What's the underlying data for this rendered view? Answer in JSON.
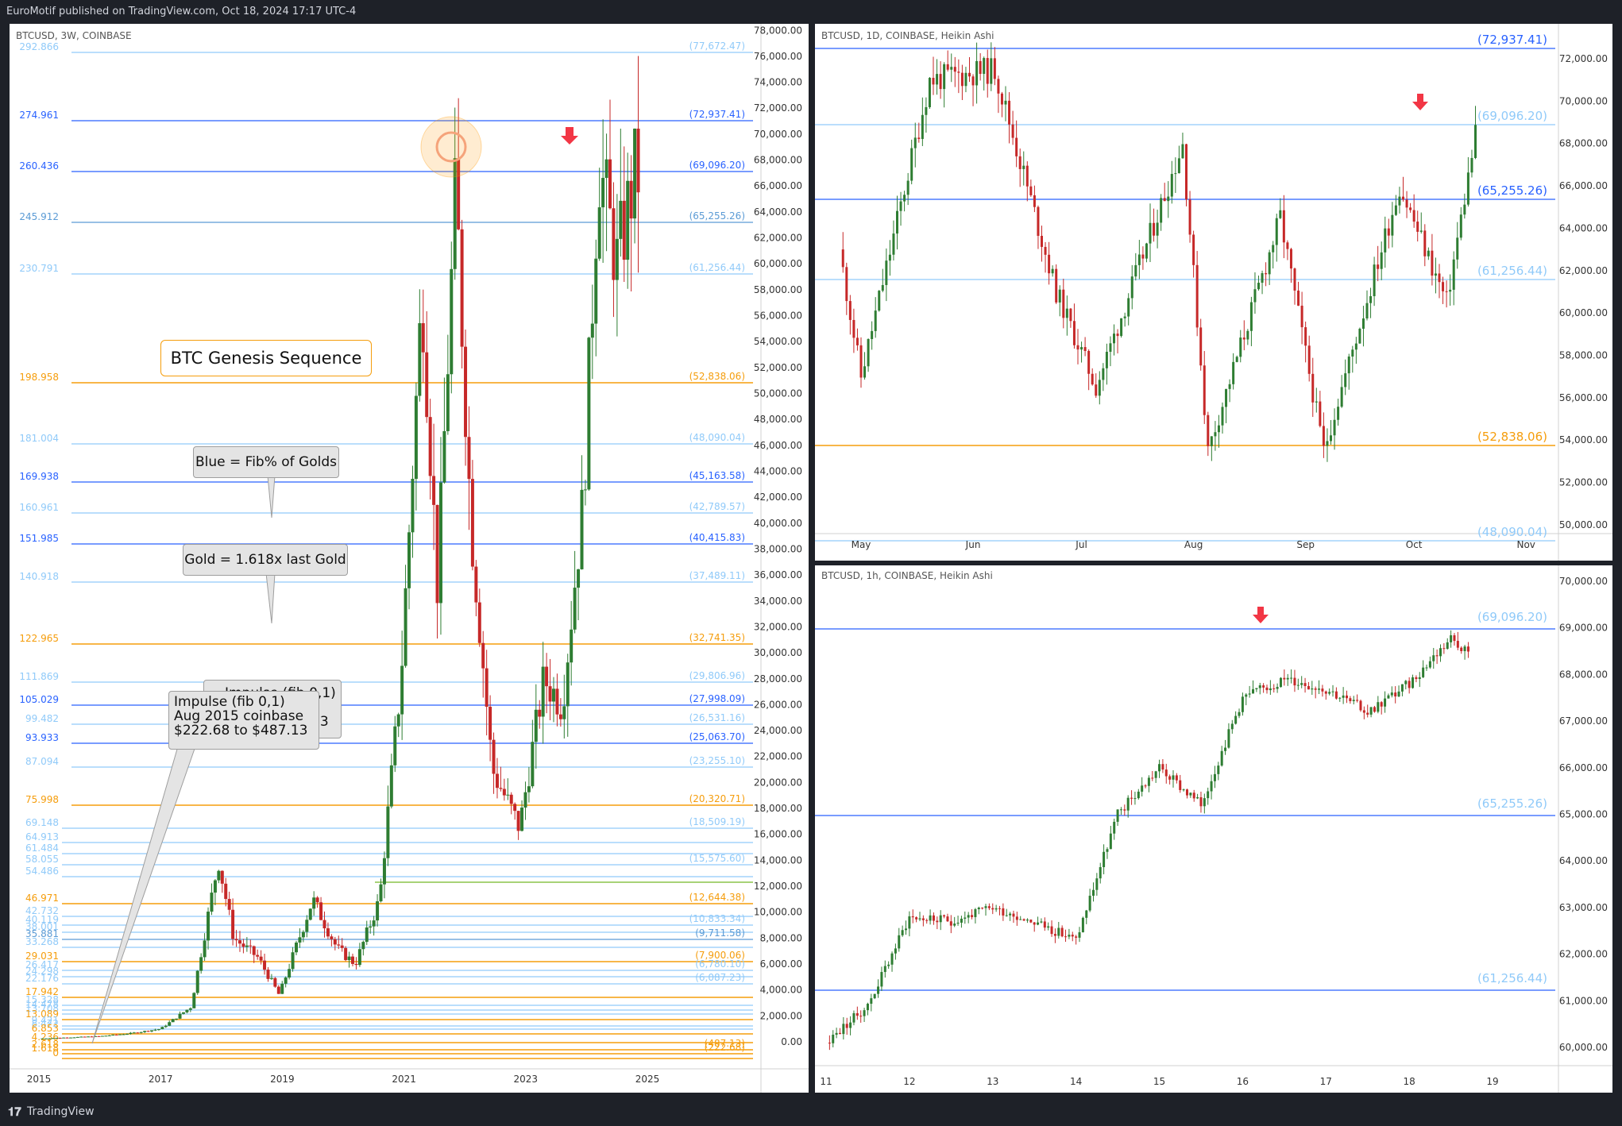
{
  "topbar": {
    "text": "EuroMotif published on TradingView.com, Oct 18, 2024 17:17 UTC-4"
  },
  "bottombar": {
    "brand": "TradingView"
  },
  "colors": {
    "blue": "#2962ff",
    "lightblue": "#90caf9",
    "midblue": "#5b9bd5",
    "orange": "#f59d0c",
    "green": "#2e7d32",
    "red": "#c62828",
    "arrow": "#f23645"
  },
  "left_panel": {
    "header": "BTCUSD, 3W, COINBASE",
    "callouts": {
      "genesis": "BTC Genesis Sequence",
      "blue_note": "Blue = Fib% of Golds",
      "gold_note": "Gold = 1.618x last Gold",
      "impulse_line1": "Impulse (fib 0,1)",
      "impulse_line2": "Aug 2015 coinbase",
      "impulse_line3": "$222.68 to $487.13",
      "impulse_ghost1": "Impulse (fib 0,1)",
      "impulse_ghost2": "se",
      "impulse_ghost3": "13"
    },
    "fib_levels": [
      {
        "pct": "292.866",
        "price": "(77,672.47)",
        "y": 36,
        "c": "lb"
      },
      {
        "pct": "274.961",
        "price": "(72,937.41)",
        "y": 122,
        "c": "b"
      },
      {
        "pct": "260.436",
        "price": "(69,096.20)",
        "y": 186,
        "c": "b"
      },
      {
        "pct": "245.912",
        "price": "(65,255.26)",
        "y": 250,
        "c": "mb"
      },
      {
        "pct": "230.791",
        "price": "(61,256.44)",
        "y": 315,
        "c": "lb"
      },
      {
        "pct": "198.958",
        "price": "(52,838.06)",
        "y": 452,
        "c": "o"
      },
      {
        "pct": "181.004",
        "price": "(48,090.04)",
        "y": 529,
        "c": "lb"
      },
      {
        "pct": "169.938",
        "price": "(45,163.58)",
        "y": 577,
        "c": "b"
      },
      {
        "pct": "160.961",
        "price": "(42,789.57)",
        "y": 616,
        "c": "lb"
      },
      {
        "pct": "151.985",
        "price": "(40,415.83)",
        "y": 655,
        "c": "b"
      },
      {
        "pct": "140.918",
        "price": "(37,489.11)",
        "y": 703,
        "c": "lb"
      },
      {
        "pct": "122.965",
        "price": "(32,741.35)",
        "y": 781,
        "c": "o"
      },
      {
        "pct": "111.869",
        "price": "(29,806.96)",
        "y": 829,
        "c": "lb"
      },
      {
        "pct": "105.029",
        "price": "(27,998.09)",
        "y": 858,
        "c": "b"
      },
      {
        "pct": "99.482",
        "price": "(26,531.16)",
        "y": 882,
        "c": "lb"
      },
      {
        "pct": "93.933",
        "price": "(25,063.70)",
        "y": 906,
        "c": "b"
      },
      {
        "pct": "87.094",
        "price": "(23,255.10)",
        "y": 936,
        "c": "lb"
      },
      {
        "pct": "75.998",
        "price": "(20,320.71)",
        "y": 984,
        "c": "o"
      },
      {
        "pct": "69.148",
        "price": "(18,509.19)",
        "y": 1013,
        "c": "lb"
      },
      {
        "pct": "64.913",
        "price": "",
        "y": 1031,
        "c": "lb"
      },
      {
        "pct": "61.484",
        "price": "",
        "y": 1045,
        "c": "lb"
      },
      {
        "pct": "58.055",
        "price": "(15,575.60)",
        "y": 1059,
        "c": "lb"
      },
      {
        "pct": "54.486",
        "price": "",
        "y": 1074,
        "c": "lb"
      },
      {
        "pct": "46.971",
        "price": "(12,644.38)",
        "y": 1108,
        "c": "o"
      },
      {
        "pct": "42.732",
        "price": "",
        "y": 1124,
        "c": "lb"
      },
      {
        "pct": "40.119",
        "price": "(10,833.34)",
        "y": 1135,
        "c": "lb"
      },
      {
        "pct": "38.001",
        "price": "",
        "y": 1144,
        "c": "lb"
      },
      {
        "pct": "35.881",
        "price": "(9,711.58)",
        "y": 1153,
        "c": "mb"
      },
      {
        "pct": "33.268",
        "price": "",
        "y": 1163,
        "c": "lb"
      },
      {
        "pct": "29.031",
        "price": "(7,900.06)",
        "y": 1181,
        "c": "o"
      },
      {
        "pct": "26.417",
        "price": "(6,780.10)",
        "y": 1192,
        "c": "lb"
      },
      {
        "pct": "24.298",
        "price": "",
        "y": 1200,
        "c": "lb"
      },
      {
        "pct": "22.176",
        "price": "(6,087.23)",
        "y": 1209,
        "c": "lb"
      },
      {
        "pct": "17.942",
        "price": "",
        "y": 1226,
        "c": "o"
      },
      {
        "pct": "15.328",
        "price": "",
        "y": 1236,
        "c": "lb"
      },
      {
        "pct": "14.478",
        "price": "",
        "y": 1242,
        "c": "lb"
      },
      {
        "pct": "13.708",
        "price": "",
        "y": 1247,
        "c": "lb"
      },
      {
        "pct": "13.089",
        "price": "",
        "y": 1254,
        "c": "o"
      },
      {
        "pct": "9.421",
        "price": "",
        "y": 1262,
        "c": "lb"
      },
      {
        "pct": "8.472",
        "price": "",
        "y": 1266,
        "c": "lb"
      },
      {
        "pct": "6.853",
        "price": "",
        "y": 1272,
        "c": "o"
      },
      {
        "pct": "4.236",
        "price": "",
        "y": 1283,
        "c": "o"
      },
      {
        "pct": "2.618",
        "price": "(487.13)",
        "y": 1292,
        "c": "o"
      },
      {
        "pct": "1.618",
        "price": "(222.68)",
        "y": 1297,
        "c": "o"
      },
      {
        "pct": "0",
        "price": "",
        "y": 1303,
        "c": "o"
      }
    ],
    "y_ticks": [
      "78,000.00",
      "76,000.00",
      "74,000.00",
      "72,000.00",
      "70,000.00",
      "68,000.00",
      "66,000.00",
      "64,000.00",
      "62,000.00",
      "60,000.00",
      "58,000.00",
      "56,000.00",
      "54,000.00",
      "52,000.00",
      "50,000.00",
      "48,000.00",
      "46,000.00",
      "44,000.00",
      "42,000.00",
      "40,000.00",
      "38,000.00",
      "36,000.00",
      "34,000.00",
      "32,000.00",
      "30,000.00",
      "28,000.00",
      "26,000.00",
      "24,000.00",
      "22,000.00",
      "20,000.00",
      "18,000.00",
      "16,000.00",
      "14,000.00",
      "12,000.00",
      "10,000.00",
      "8,000.00",
      "6,000.00",
      "4,000.00",
      "2,000.00",
      "0.00"
    ],
    "x_ticks": [
      "2015",
      "2017",
      "2019",
      "2021",
      "2023",
      "2025"
    ]
  },
  "right_top": {
    "header": "BTCUSD, 1D, COINBASE, Heikin Ashi",
    "levels": [
      {
        "price": "(72,937.41)",
        "c": "b"
      },
      {
        "price": "(69,096.20)",
        "c": "lb"
      },
      {
        "price": "(65,255.26)",
        "c": "b"
      },
      {
        "price": "(61,256.44)",
        "c": "lb"
      },
      {
        "price": "(52,838.06)",
        "c": "o"
      },
      {
        "price": "(48,090.04)",
        "c": "lb"
      }
    ],
    "y_ticks": [
      "72,000.00",
      "70,000.00",
      "68,000.00",
      "66,000.00",
      "64,000.00",
      "62,000.00",
      "60,000.00",
      "58,000.00",
      "56,000.00",
      "54,000.00",
      "52,000.00",
      "50,000.00"
    ],
    "x_ticks": [
      "May",
      "Jun",
      "Jul",
      "Aug",
      "Sep",
      "Oct",
      "Nov"
    ]
  },
  "right_bottom": {
    "header": "BTCUSD, 1h, COINBASE, Heikin Ashi",
    "levels": [
      {
        "price": "(69,096.20)",
        "c": "lb"
      },
      {
        "price": "(65,255.26)",
        "c": "lb"
      },
      {
        "price": "(61,256.44)",
        "c": "lb"
      }
    ],
    "y_ticks": [
      "70,000.00",
      "69,000.00",
      "68,000.00",
      "67,000.00",
      "66,000.00",
      "65,000.00",
      "64,000.00",
      "63,000.00",
      "62,000.00",
      "61,000.00",
      "60,000.00"
    ],
    "x_ticks": [
      "11",
      "12",
      "13",
      "14",
      "15",
      "16",
      "17",
      "18",
      "19"
    ]
  },
  "chart_data": [
    {
      "type": "candlestick",
      "title": "BTCUSD, 3W, COINBASE",
      "ylim": [
        0,
        78000
      ],
      "x_ticks": [
        "2015",
        "2017",
        "2019",
        "2021",
        "2023",
        "2025"
      ],
      "close_path": [
        [
          2015.0,
          250
        ],
        [
          2016.0,
          430
        ],
        [
          2016.5,
          650
        ],
        [
          2017.0,
          1000
        ],
        [
          2017.5,
          2700
        ],
        [
          2017.95,
          14000
        ],
        [
          2018.2,
          8000
        ],
        [
          2018.6,
          6500
        ],
        [
          2018.95,
          3600
        ],
        [
          2019.5,
          11000
        ],
        [
          2019.9,
          7200
        ],
        [
          2020.2,
          6000
        ],
        [
          2020.6,
          11000
        ],
        [
          2020.95,
          28000
        ],
        [
          2021.3,
          58000
        ],
        [
          2021.55,
          35000
        ],
        [
          2021.85,
          66000
        ],
        [
          2022.1,
          40000
        ],
        [
          2022.45,
          21000
        ],
        [
          2022.9,
          16500
        ],
        [
          2023.3,
          28000
        ],
        [
          2023.6,
          26000
        ],
        [
          2023.95,
          42000
        ],
        [
          2024.2,
          68000
        ],
        [
          2024.5,
          60000
        ],
        [
          2024.8,
          67000
        ]
      ],
      "annotations": [
        "BTC Genesis Sequence",
        "Blue = Fib% of Golds",
        "Gold = 1.618x last Gold"
      ]
    },
    {
      "type": "candlestick",
      "title": "BTCUSD, 1D, COINBASE, Heikin Ashi",
      "ylim": [
        48000,
        73500
      ],
      "x_ticks": [
        "May",
        "Jun",
        "Jul",
        "Aug",
        "Sep",
        "Oct",
        "Nov"
      ],
      "close_path": [
        [
          "Apr 25",
          63000
        ],
        [
          "May 1",
          57000
        ],
        [
          "May 20",
          71000
        ],
        [
          "Jun 7",
          71500
        ],
        [
          "Jun 24",
          61000
        ],
        [
          "Jul 5",
          56500
        ],
        [
          "Jul 29",
          68000
        ],
        [
          "Aug 5",
          53500
        ],
        [
          "Aug 25",
          64500
        ],
        [
          "Sep 6",
          53500
        ],
        [
          "Sep 27",
          66000
        ],
        [
          "Oct 10",
          60500
        ],
        [
          "Oct 18",
          68400
        ]
      ]
    },
    {
      "type": "candlestick",
      "title": "BTCUSD, 1h, COINBASE, Heikin Ashi",
      "ylim": [
        59600,
        70200
      ],
      "x_ticks": [
        "11",
        "12",
        "13",
        "14",
        "15",
        "16",
        "17",
        "18",
        "19"
      ],
      "close_path": [
        [
          "Oct 11 00:00",
          60100
        ],
        [
          "Oct 11 12:00",
          60900
        ],
        [
          "Oct 12 00:00",
          62800
        ],
        [
          "Oct 12 12:00",
          62700
        ],
        [
          "Oct 13 00:00",
          63000
        ],
        [
          "Oct 13 12:00",
          62700
        ],
        [
          "Oct 14 00:00",
          62300
        ],
        [
          "Oct 14 12:00",
          65000
        ],
        [
          "Oct 15 00:00",
          66000
        ],
        [
          "Oct 15 12:00",
          65200
        ],
        [
          "Oct 16 00:00",
          67500
        ],
        [
          "Oct 16 12:00",
          67900
        ],
        [
          "Oct 17 00:00",
          67700
        ],
        [
          "Oct 17 12:00",
          67200
        ],
        [
          "Oct 18 00:00",
          67800
        ],
        [
          "Oct 18 12:00",
          68800
        ],
        [
          "Oct 18 17:00",
          68500
        ]
      ]
    }
  ]
}
